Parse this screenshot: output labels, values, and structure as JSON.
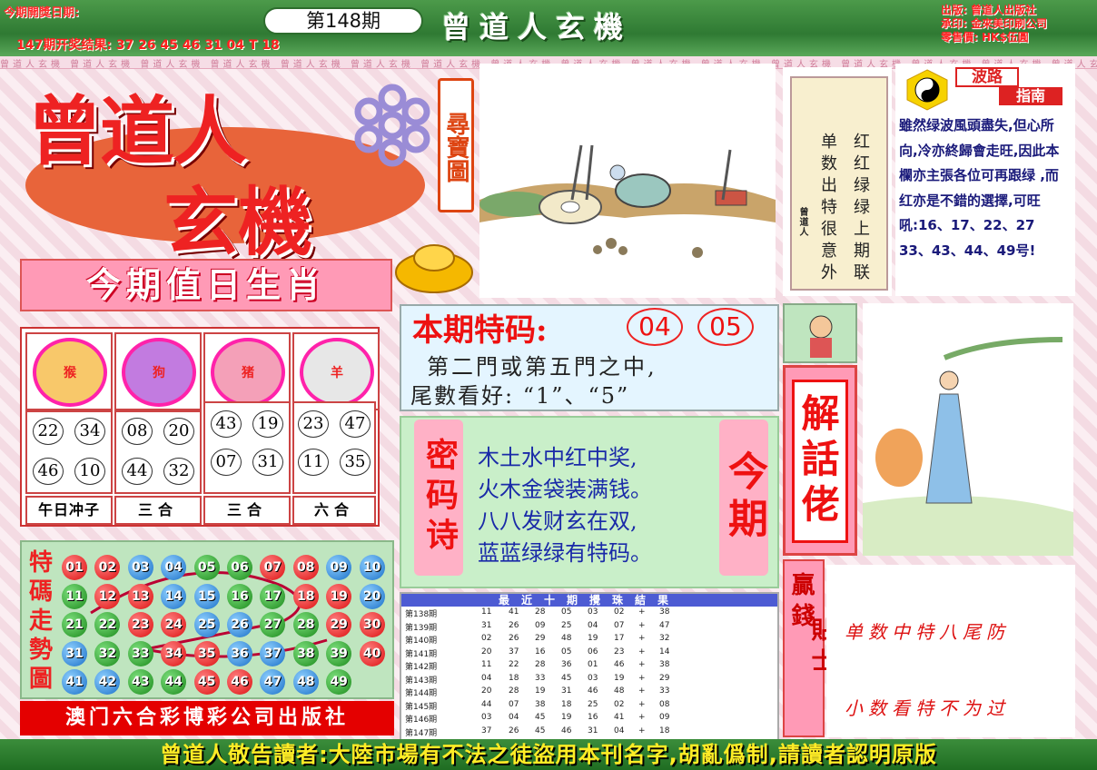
{
  "header": {
    "date_label": "今期開獎日期:",
    "last_result": "147期开奖结果: 37 26 45 46 31 04 T 18",
    "issue": "第148期",
    "brand": "曾道人玄機",
    "publisher": [
      "出版: 曾道人出版社",
      "承印: 金來美印刷公司",
      "零售價: HK$伍圓"
    ]
  },
  "strip_text": "曾道人玄機",
  "logo": {
    "line1": "曾道人",
    "line2": "玄機",
    "side": "尋寶圖"
  },
  "zodiac": {
    "title": "今期值日生肖",
    "animals": [
      "猴",
      "狗",
      "猪",
      "羊"
    ],
    "numbers": [
      [
        "22",
        "34",
        "46",
        "10"
      ],
      [
        "08",
        "20",
        "44",
        "32"
      ],
      [
        "43",
        "19",
        "07",
        "31"
      ],
      [
        "23",
        "47",
        "11",
        "35"
      ]
    ],
    "labels": [
      "午日冲子",
      "三合",
      "三合",
      "六合"
    ]
  },
  "grid": {
    "label": "特碼走勢圖",
    "rows": [
      [
        [
          "01",
          "red"
        ],
        [
          "02",
          "red"
        ],
        [
          "03",
          "blue"
        ],
        [
          "04",
          "blue"
        ],
        [
          "05",
          "green"
        ],
        [
          "06",
          "green"
        ],
        [
          "07",
          "red"
        ],
        [
          "08",
          "red"
        ],
        [
          "09",
          "blue"
        ],
        [
          "10",
          "blue"
        ]
      ],
      [
        [
          "11",
          "green"
        ],
        [
          "12",
          "red"
        ],
        [
          "13",
          "red"
        ],
        [
          "14",
          "blue"
        ],
        [
          "15",
          "blue"
        ],
        [
          "16",
          "green"
        ],
        [
          "17",
          "green"
        ],
        [
          "18",
          "red"
        ],
        [
          "19",
          "red"
        ],
        [
          "20",
          "blue"
        ]
      ],
      [
        [
          "21",
          "green"
        ],
        [
          "22",
          "green"
        ],
        [
          "23",
          "red"
        ],
        [
          "24",
          "red"
        ],
        [
          "25",
          "blue"
        ],
        [
          "26",
          "blue"
        ],
        [
          "27",
          "green"
        ],
        [
          "28",
          "green"
        ],
        [
          "29",
          "red"
        ],
        [
          "30",
          "red"
        ]
      ],
      [
        [
          "31",
          "blue"
        ],
        [
          "32",
          "green"
        ],
        [
          "33",
          "green"
        ],
        [
          "34",
          "red"
        ],
        [
          "35",
          "red"
        ],
        [
          "36",
          "blue"
        ],
        [
          "37",
          "blue"
        ],
        [
          "38",
          "green"
        ],
        [
          "39",
          "green"
        ],
        [
          "40",
          "red"
        ]
      ],
      [
        [
          "41",
          "blue"
        ],
        [
          "42",
          "blue"
        ],
        [
          "43",
          "green"
        ],
        [
          "44",
          "green"
        ],
        [
          "45",
          "red"
        ],
        [
          "46",
          "red"
        ],
        [
          "47",
          "blue"
        ],
        [
          "48",
          "blue"
        ],
        [
          "49",
          "green"
        ]
      ]
    ]
  },
  "macau": "澳门六合彩博彩公司出版社",
  "special": {
    "title": "本期特码:",
    "nums": [
      "04",
      "05"
    ],
    "line1": "第二門或第五門之中,",
    "line2": "尾數看好:  “1”、“5”"
  },
  "poem": {
    "left_label": "密码诗",
    "right_label": "今期",
    "lines": [
      "木土水中红中奖,",
      "火木金袋装满钱。",
      "八八发财玄在双,",
      "蓝蓝绿绿有特码。"
    ]
  },
  "results": {
    "title": "最近十期攪珠結果",
    "rows": [
      [
        "第138期",
        "11",
        "41",
        "28",
        "05",
        "03",
        "02",
        "+",
        "38"
      ],
      [
        "第139期",
        "31",
        "26",
        "09",
        "25",
        "04",
        "07",
        "+",
        "47"
      ],
      [
        "第140期",
        "02",
        "26",
        "29",
        "48",
        "19",
        "17",
        "+",
        "32"
      ],
      [
        "第141期",
        "20",
        "37",
        "16",
        "05",
        "06",
        "23",
        "+",
        "14"
      ],
      [
        "第142期",
        "11",
        "22",
        "28",
        "36",
        "01",
        "46",
        "+",
        "38"
      ],
      [
        "第143期",
        "04",
        "18",
        "33",
        "45",
        "03",
        "19",
        "+",
        "29"
      ],
      [
        "第144期",
        "20",
        "28",
        "19",
        "31",
        "46",
        "48",
        "+",
        "33"
      ],
      [
        "第145期",
        "44",
        "07",
        "38",
        "18",
        "25",
        "02",
        "+",
        "08"
      ],
      [
        "第146期",
        "03",
        "04",
        "45",
        "19",
        "16",
        "41",
        "+",
        "09"
      ],
      [
        "第147期",
        "37",
        "26",
        "45",
        "46",
        "31",
        "04",
        "+",
        "18"
      ]
    ]
  },
  "scroll": {
    "col1": "红红绿绿上期联",
    "col2": "单数出特很意外",
    "sign": "曾道人"
  },
  "guide": {
    "title1": "波路",
    "title2": "指南",
    "text": "雖然绿波風頭盡失,但心所向,冷亦終歸會走旺,因此本欄亦主張各位可再跟绿 ,而 红亦是不錯的選擇,可旺吼:16、17、22、27 33、43、44、49号!"
  },
  "riddle": {
    "label": "解話佬"
  },
  "tips": {
    "label1": "贏錢",
    "label2": "貼士",
    "line1": "单数中特八尾防",
    "line2": "小数看特不为过"
  },
  "footer": "曾道人敬告讀者:大陸市場有不法之徒盜用本刊名字,胡亂僞制,請讀者認明原版"
}
